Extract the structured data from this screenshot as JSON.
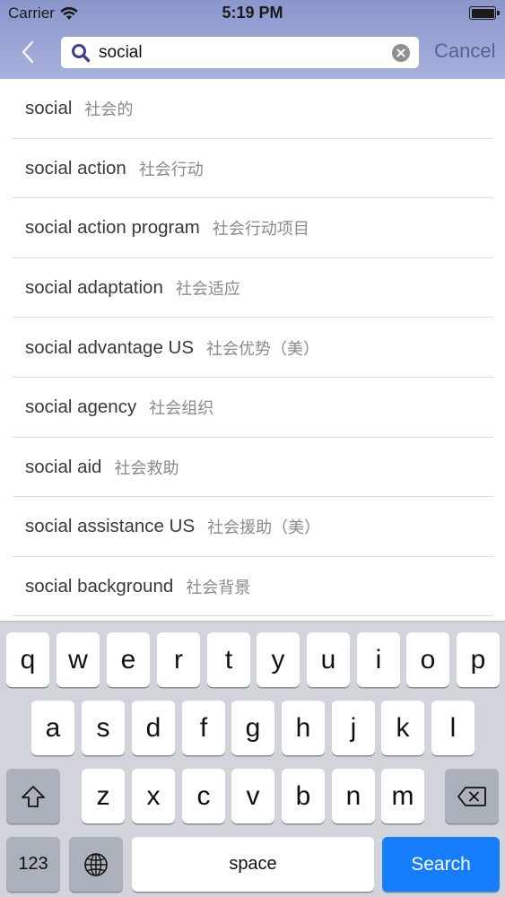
{
  "status_bar": {
    "carrier": "Carrier",
    "time": "5:19 PM"
  },
  "search": {
    "value": "social",
    "cancel_label": "Cancel"
  },
  "suggestions": [
    {
      "en": "social",
      "zh": "社会的"
    },
    {
      "en": "social action",
      "zh": "社会行动"
    },
    {
      "en": "social action program",
      "zh": "社会行动项目"
    },
    {
      "en": "social adaptation",
      "zh": "社会适应"
    },
    {
      "en": "social advantage US",
      "zh": "社会优势（美）"
    },
    {
      "en": "social agency",
      "zh": "社会组织"
    },
    {
      "en": "social aid",
      "zh": "社会救助"
    },
    {
      "en": "social assistance US",
      "zh": "社会援助（美）"
    },
    {
      "en": "social background",
      "zh": "社会背景"
    }
  ],
  "keyboard": {
    "row1": [
      "q",
      "w",
      "e",
      "r",
      "t",
      "y",
      "u",
      "i",
      "o",
      "p"
    ],
    "row2": [
      "a",
      "s",
      "d",
      "f",
      "g",
      "h",
      "j",
      "k",
      "l"
    ],
    "row3": [
      "z",
      "x",
      "c",
      "v",
      "b",
      "n",
      "m"
    ],
    "numbers_label": "123",
    "space_label": "space",
    "search_label": "Search"
  },
  "colors": {
    "header": "#8b96cc",
    "search_key": "#167efb",
    "keyboard_bg": "#d1d5db"
  }
}
